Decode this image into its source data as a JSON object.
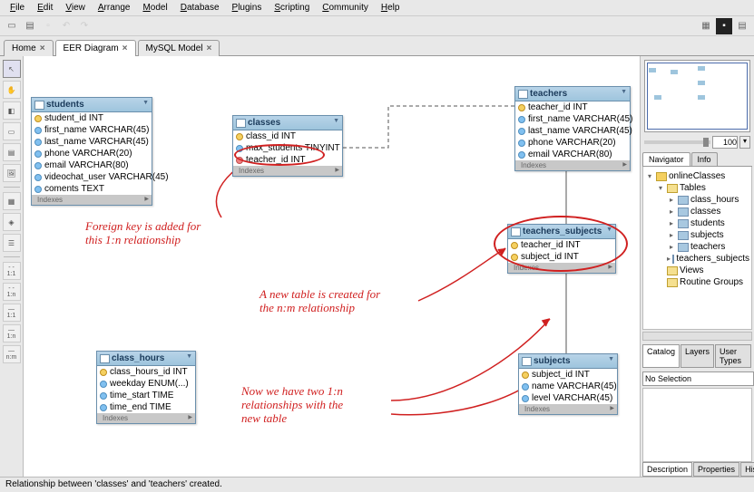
{
  "menu": {
    "items": [
      "File",
      "Edit",
      "View",
      "Arrange",
      "Model",
      "Database",
      "Plugins",
      "Scripting",
      "Community",
      "Help"
    ]
  },
  "tabs": {
    "items": [
      {
        "label": "Home",
        "close": true
      },
      {
        "label": "EER Diagram",
        "close": true,
        "active": true
      },
      {
        "label": "MySQL Model",
        "close": true
      }
    ]
  },
  "zoom": {
    "value": "100"
  },
  "nav": {
    "tabs": [
      "Navigator",
      "Info"
    ],
    "active": 0
  },
  "tree": {
    "root": "onlineClasses",
    "tables_label": "Tables",
    "tables": [
      "class_hours",
      "classes",
      "students",
      "subjects",
      "teachers",
      "teachers_subjects"
    ],
    "views": "Views",
    "routines": "Routine Groups"
  },
  "catalog": {
    "tabs": [
      "Catalog",
      "Layers",
      "User Types"
    ],
    "active": 0
  },
  "selection": {
    "value": "No Selection"
  },
  "desc": {
    "tabs": [
      "Description",
      "Properties",
      "History"
    ],
    "active": 0
  },
  "status": "Relationship between 'classes' and 'teachers' created.",
  "entities": {
    "students": {
      "title": "students",
      "cols": [
        {
          "n": "student_id INT",
          "t": "pk"
        },
        {
          "n": "first_name VARCHAR(45)",
          "t": "at"
        },
        {
          "n": "last_name VARCHAR(45)",
          "t": "at"
        },
        {
          "n": "phone VARCHAR(20)",
          "t": "at"
        },
        {
          "n": "email VARCHAR(80)",
          "t": "at"
        },
        {
          "n": "videochat_user VARCHAR(45)",
          "t": "at"
        },
        {
          "n": "coments TEXT",
          "t": "at"
        }
      ],
      "idx": "Indexes"
    },
    "classes": {
      "title": "classes",
      "cols": [
        {
          "n": "class_id INT",
          "t": "pk"
        },
        {
          "n": "max_students TINYINT",
          "t": "at"
        },
        {
          "n": "teacher_id INT",
          "t": "fk"
        }
      ],
      "idx": "Indexes"
    },
    "teachers": {
      "title": "teachers",
      "cols": [
        {
          "n": "teacher_id INT",
          "t": "pk"
        },
        {
          "n": "first_name VARCHAR(45)",
          "t": "at"
        },
        {
          "n": "last_name VARCHAR(45)",
          "t": "at"
        },
        {
          "n": "phone VARCHAR(20)",
          "t": "at"
        },
        {
          "n": "email VARCHAR(80)",
          "t": "at"
        }
      ],
      "idx": "Indexes"
    },
    "teachers_subjects": {
      "title": "teachers_subjects",
      "cols": [
        {
          "n": "teacher_id INT",
          "t": "pk"
        },
        {
          "n": "subject_id INT",
          "t": "pk"
        }
      ],
      "idx": "Indexes"
    },
    "subjects": {
      "title": "subjects",
      "cols": [
        {
          "n": "subject_id INT",
          "t": "pk"
        },
        {
          "n": "name VARCHAR(45)",
          "t": "at"
        },
        {
          "n": "level VARCHAR(45)",
          "t": "at"
        }
      ],
      "idx": "Indexes"
    },
    "class_hours": {
      "title": "class_hours",
      "cols": [
        {
          "n": "class_hours_id INT",
          "t": "pk"
        },
        {
          "n": "weekday ENUM(...)",
          "t": "at"
        },
        {
          "n": "time_start TIME",
          "t": "at"
        },
        {
          "n": "time_end TIME",
          "t": "at"
        }
      ],
      "idx": "Indexes"
    }
  },
  "annotations": {
    "a1": "Foreign key is added for\nthis 1:n relationship",
    "a2": "A new table is created for\nthe n:m relationship",
    "a3": "Now we have two 1:n\nrelationships with the\nnew table"
  },
  "tooltips": {
    "ltools": [
      "pointer",
      "hand",
      "eraser",
      "layer",
      "note",
      "image",
      "table",
      "view",
      "routine",
      "rel-1-1-nid",
      "rel-1-n-nid",
      "rel-1-1-id",
      "rel-1-n-id",
      "rel-n-m"
    ]
  }
}
